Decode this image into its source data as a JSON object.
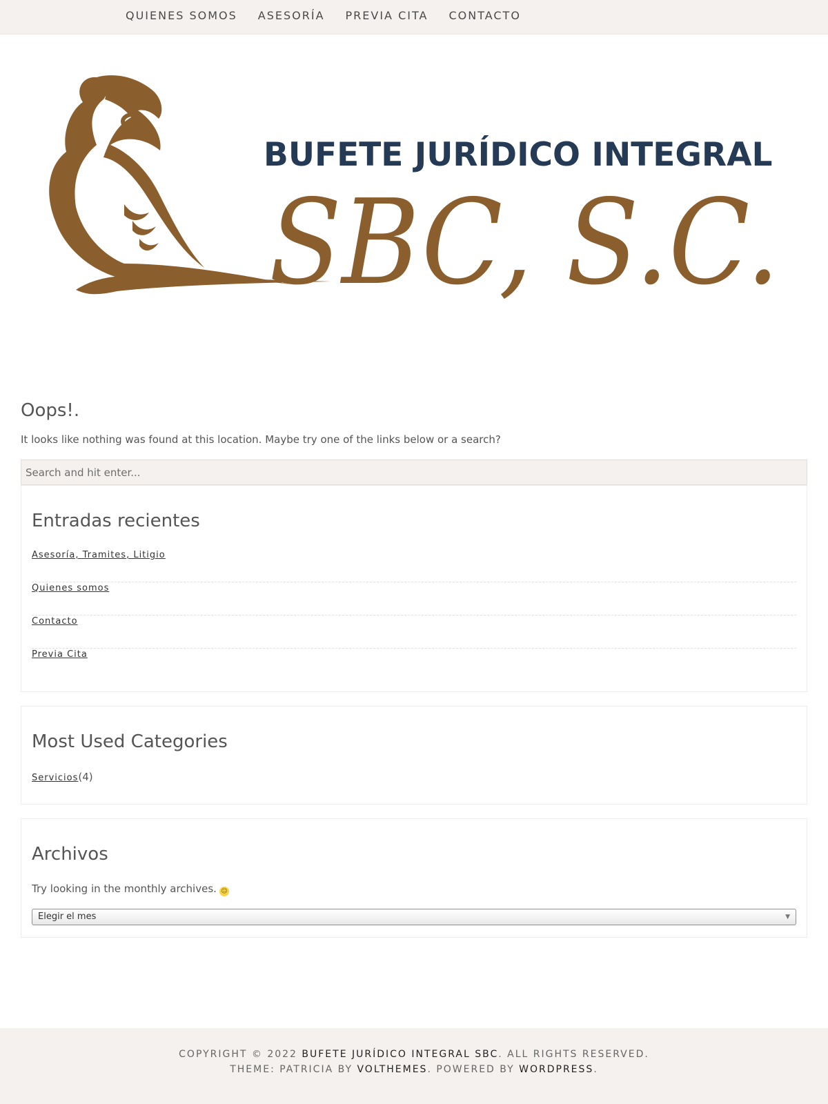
{
  "nav": {
    "items": [
      {
        "label": "QUIENES SOMOS"
      },
      {
        "label": "ASESORÍA"
      },
      {
        "label": "PREVIA CITA"
      },
      {
        "label": "CONTACTO"
      }
    ]
  },
  "logo": {
    "line1": "BUFETE JURÍDICO INTEGRAL",
    "line2": "SBC, S.C.",
    "colors": {
      "navy": "#243a55",
      "bronze": "#8b5e2d"
    }
  },
  "error": {
    "title": "Oops!.",
    "message": "It looks like nothing was found at this location. Maybe try one of the links below or a search?"
  },
  "search": {
    "placeholder": "Search and hit enter..."
  },
  "recent": {
    "title": "Entradas recientes",
    "items": [
      {
        "label": "Asesoría, Tramites, Litigio"
      },
      {
        "label": "Quienes somos"
      },
      {
        "label": "Contacto"
      },
      {
        "label": "Previa Cita"
      }
    ]
  },
  "categories": {
    "title": "Most Used Categories",
    "items": [
      {
        "label": "Servicios",
        "count": "(4)"
      }
    ]
  },
  "archives": {
    "title": "Archivos",
    "text": "Try looking in the monthly archives.",
    "select_value": "Elegir el mes"
  },
  "footer": {
    "copyright_prefix": "COPYRIGHT © 2022",
    "site_link": "BUFETE JURÍDICO INTEGRAL SBC",
    "rights": ". ALL RIGHTS RESERVED.",
    "theme_prefix": "THEME: PATRICIA BY",
    "theme_link": "VOLTHEMES",
    "powered": ". POWERED BY",
    "wp_link": "WORDPRESS",
    "end": "."
  }
}
